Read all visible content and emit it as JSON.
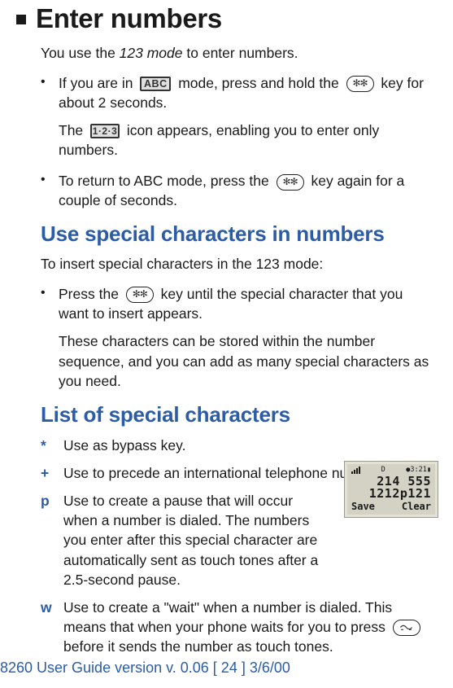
{
  "section1": {
    "title": "Enter numbers",
    "intro_pre": "You use the ",
    "intro_mode": "123 mode",
    "intro_post": " to enter numbers.",
    "li1_pre": "If you are in ",
    "li1_mid": " mode, press and hold the ",
    "li1_post": " key for about 2 seconds.",
    "sub1_pre": "The ",
    "sub1_post": " icon appears, enabling you to enter only numbers.",
    "li2_pre": "To return to ABC mode, press the ",
    "li2_post": " key again for a couple of seconds."
  },
  "section2": {
    "title": "Use special characters in numbers",
    "intro": "To insert special characters in the 123 mode:",
    "li1_pre": "Press the ",
    "li1_post": " key until the special character that you want to insert appears.",
    "sub": "These characters can be stored within the number sequence, and you can add as many special characters as you need."
  },
  "section3": {
    "title": "List of special characters",
    "items": [
      {
        "sym": "*",
        "desc": "Use as bypass key."
      },
      {
        "sym": "+",
        "desc": "Use to precede an international telephone number."
      },
      {
        "sym": "p",
        "desc": "Use to create a pause that will occur when a number is dialed. The numbers you enter after this special character are automatically sent as touch tones after a 2.5-second pause."
      },
      {
        "sym": "w",
        "desc_pre": "Use to create a \"wait\" when a number is dialed. This means that when your phone waits for you to press ",
        "desc_post": " before it sends the number as touch tones."
      }
    ]
  },
  "phone": {
    "status_left": "D",
    "status_right": "●3:21▮",
    "line1": "214 555",
    "line2": "1212p121",
    "soft_left": "Save",
    "soft_right": "Clear"
  },
  "icons": {
    "abc_label": "ABC",
    "num_label": "1·2·3"
  },
  "footer": "8260 User Guide version v. 0.06 [ 24 ] 3/6/00"
}
